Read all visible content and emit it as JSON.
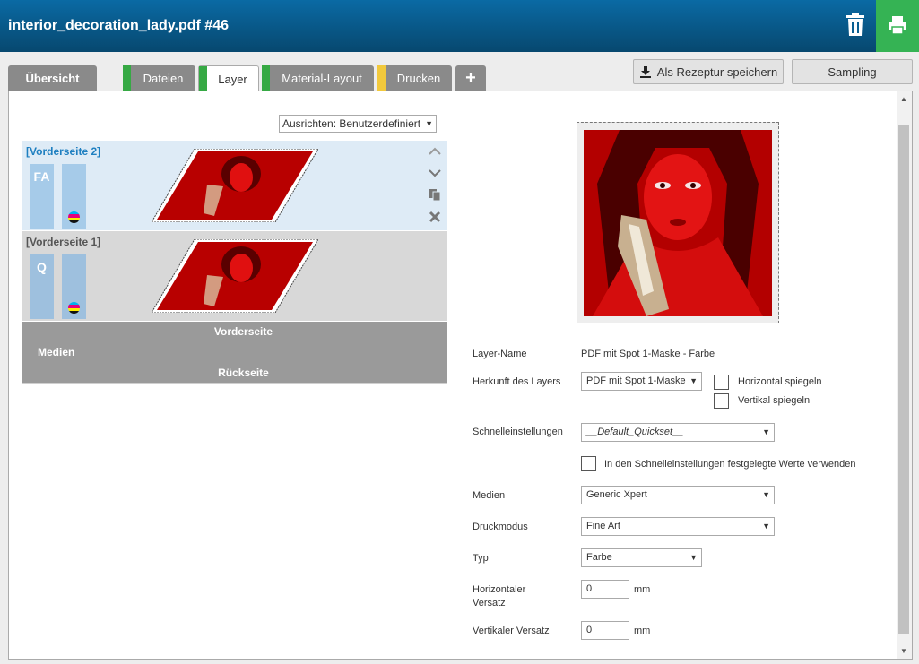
{
  "window": {
    "title": "interior_decoration_lady.pdf #46"
  },
  "tabs": [
    {
      "label": "Übersicht",
      "stripe": ""
    },
    {
      "label": "Dateien",
      "stripe": "#36a944"
    },
    {
      "label": "Layer",
      "stripe": "#36a944"
    },
    {
      "label": "Material-Layout",
      "stripe": "#36a944"
    },
    {
      "label": "Drucken",
      "stripe": "#f2c93c"
    },
    {
      "label": "+",
      "stripe": ""
    }
  ],
  "toolbar": {
    "recipe_label": "Als Rezeptur speichern",
    "sampling_label": "Sampling"
  },
  "align": {
    "label": "Ausrichten: Benutzerdefiniert"
  },
  "layers": [
    {
      "name": "[Vorderseite 2]",
      "chip": "FA",
      "selected": true
    },
    {
      "name": "[Vorderseite 1]",
      "chip": "Q",
      "selected": false
    }
  ],
  "media": {
    "front": "Vorderseite",
    "media": "Medien",
    "back": "Rückseite"
  },
  "form": {
    "layer_name": {
      "label": "Layer-Name",
      "value": "PDF mit Spot 1-Maske - Farbe"
    },
    "origin": {
      "label": "Herkunft des Layers",
      "value": "PDF mit Spot 1-Maske"
    },
    "flip_h": "Horizontal spiegeln",
    "flip_v": "Vertikal spiegeln",
    "quick": {
      "label": "Schnelleinstellungen",
      "value": "__Default_Quickset__"
    },
    "use_quick": "In den Schnelleinstellungen festgelegte Werte verwenden",
    "media": {
      "label": "Medien",
      "value": "Generic Xpert"
    },
    "mode": {
      "label": "Druckmodus",
      "value": "Fine Art"
    },
    "type": {
      "label": "Typ",
      "value": "Farbe"
    },
    "h_offset": {
      "label_1": "Horizontaler",
      "label_2": "Versatz",
      "value": "0",
      "unit": "mm"
    },
    "v_offset": {
      "label": "Vertikaler Versatz",
      "value": "0",
      "unit": "mm"
    }
  },
  "colors": {
    "title_bar": "#0a5f92",
    "print_green": "#35b354",
    "selected_row": "#deebf6",
    "media_gray": "#9a9a9a"
  }
}
